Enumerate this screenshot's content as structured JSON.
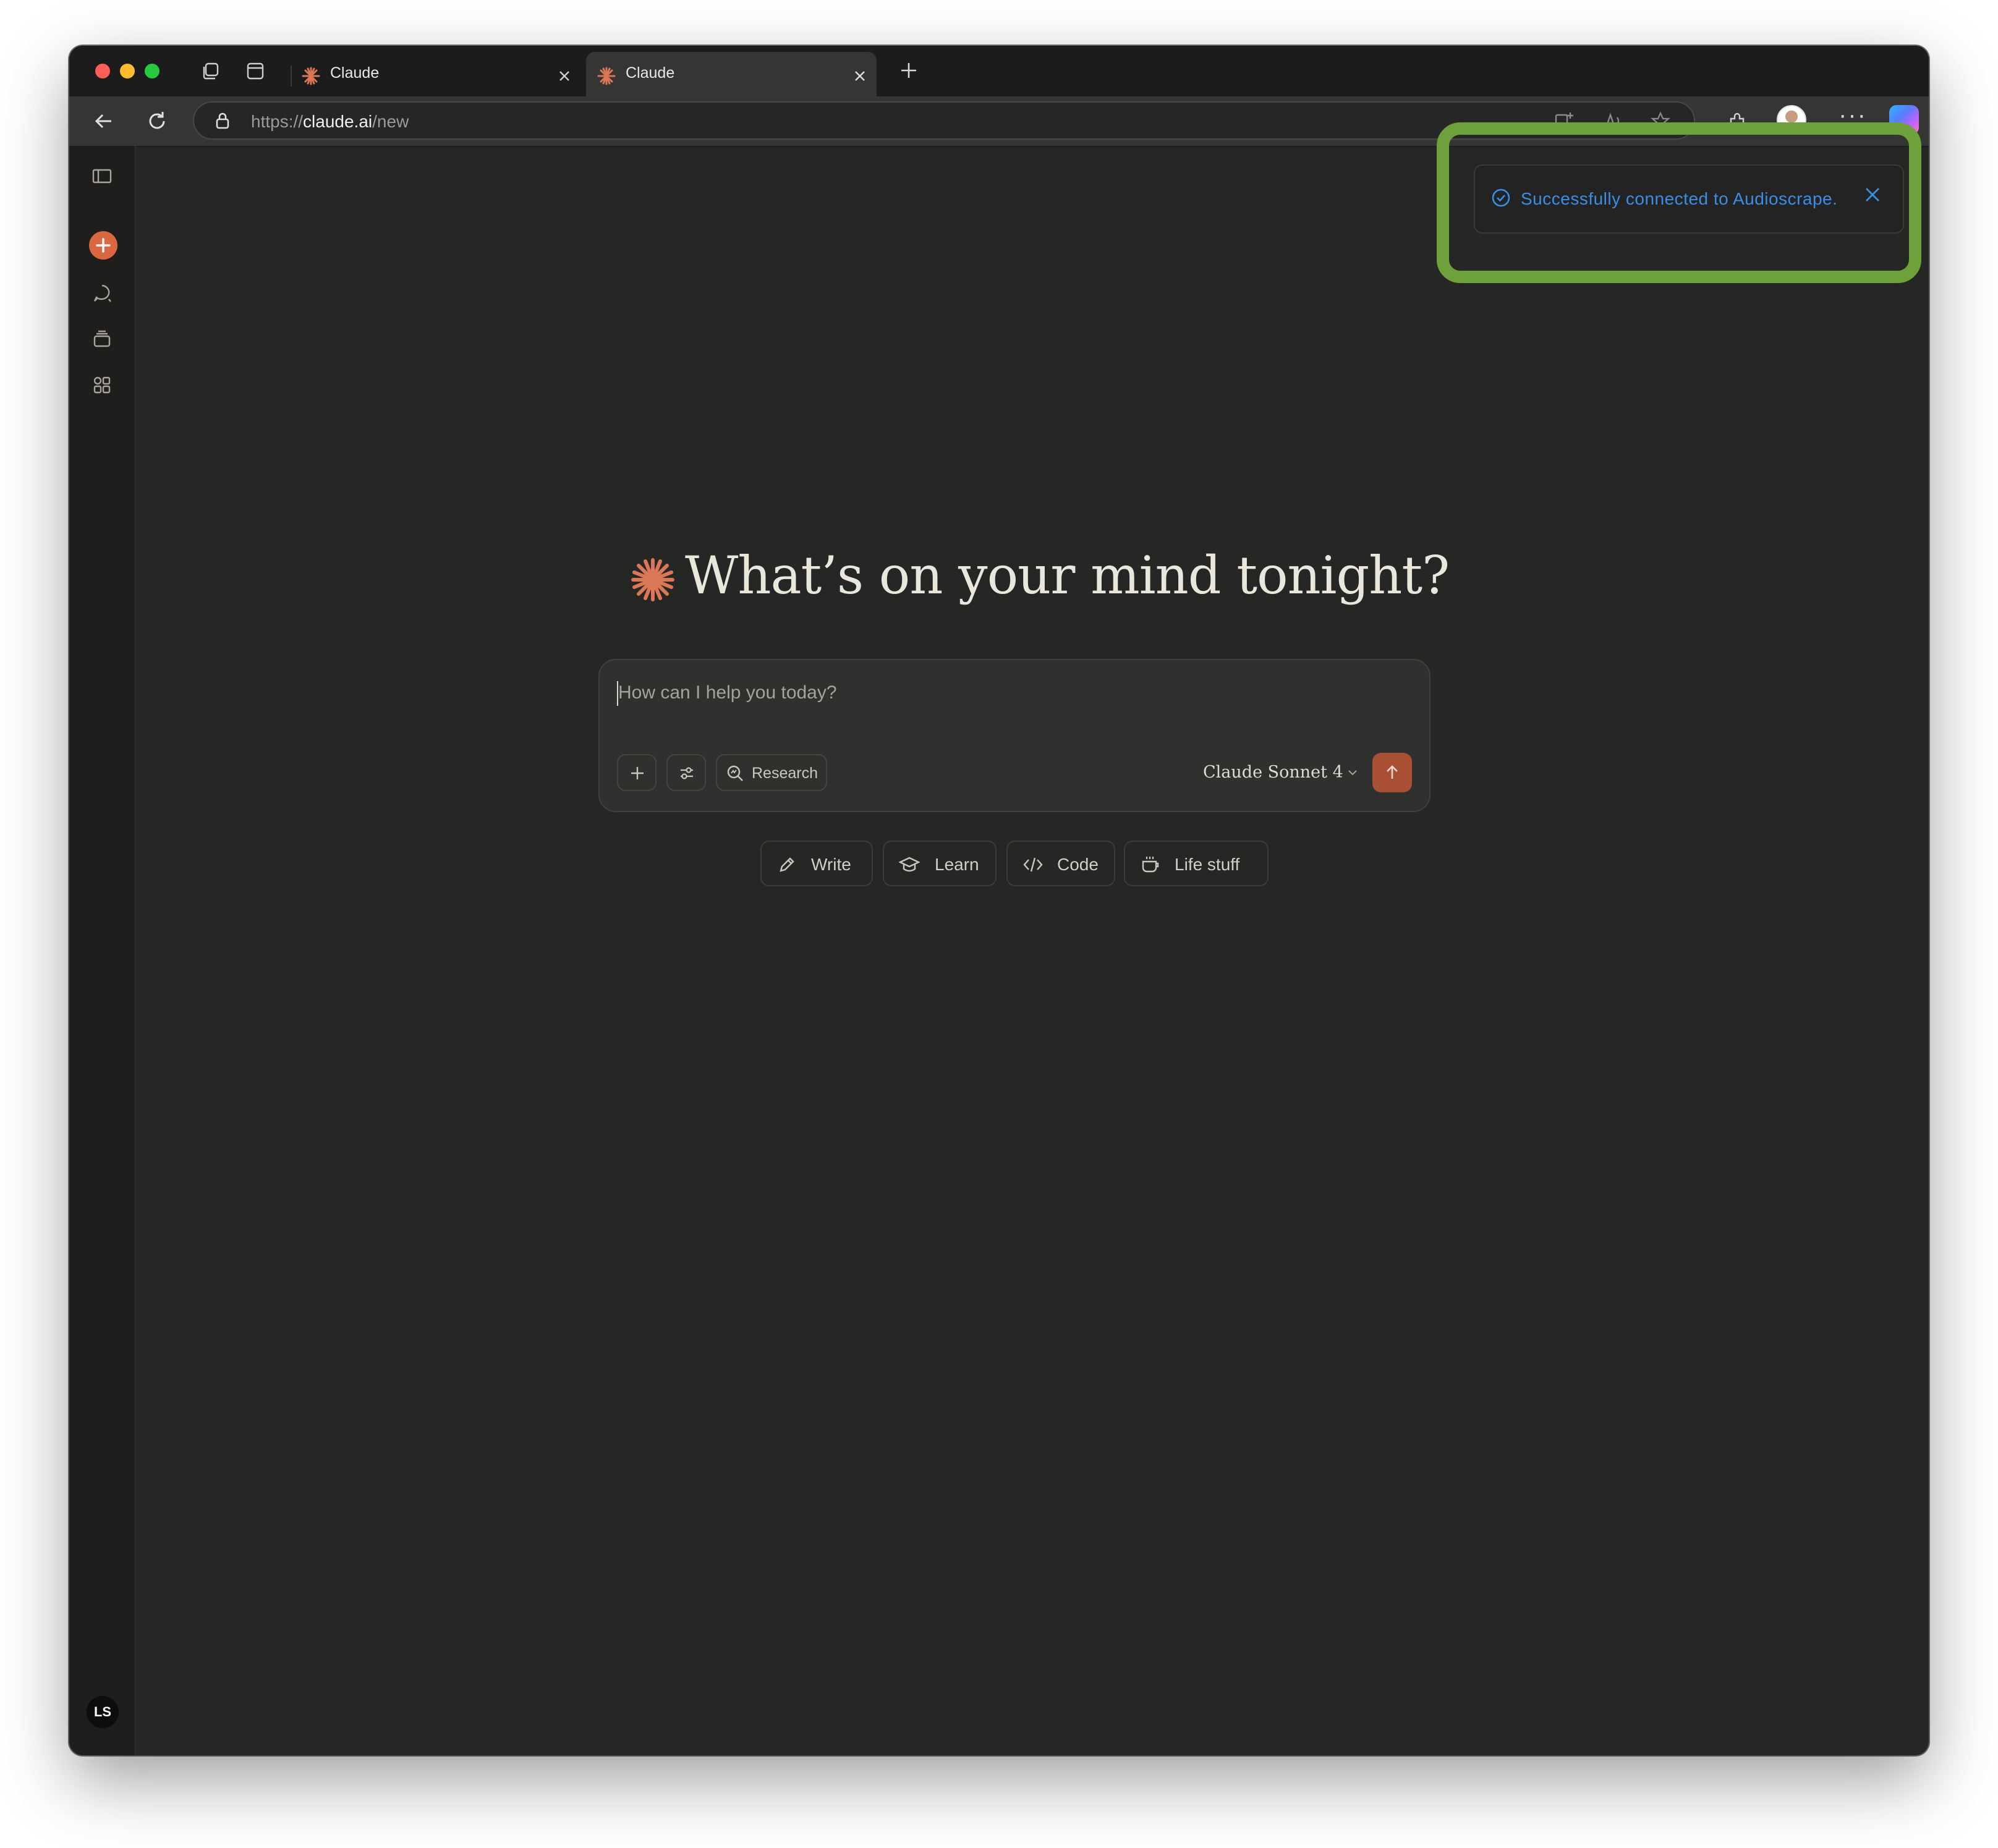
{
  "browser": {
    "tabs": [
      {
        "title": "Claude",
        "active": false
      },
      {
        "title": "Claude",
        "active": true
      }
    ],
    "url": {
      "scheme": "https://",
      "host": "claude.ai",
      "path": "/new"
    },
    "menu_dots": "···"
  },
  "sidebar": {
    "user_initials": "LS"
  },
  "main": {
    "greeting": "What’s on your mind tonight?",
    "composer": {
      "placeholder": "How can I help you today?",
      "research_label": "Research",
      "model_label": "Claude Sonnet 4"
    },
    "chips": [
      {
        "label": "Write",
        "icon": "pencil-icon"
      },
      {
        "label": "Learn",
        "icon": "graduation-cap-icon"
      },
      {
        "label": "Code",
        "icon": "code-icon"
      },
      {
        "label": "Life stuff",
        "icon": "coffee-cup-icon"
      }
    ]
  },
  "toast": {
    "message": "Successfully connected to Audioscrape."
  },
  "colors": {
    "accent": "#d9673f",
    "send_button": "#a94f34",
    "toast_text": "#3a8ee6",
    "highlight_outline": "#6ea03b",
    "background": "#262624"
  }
}
